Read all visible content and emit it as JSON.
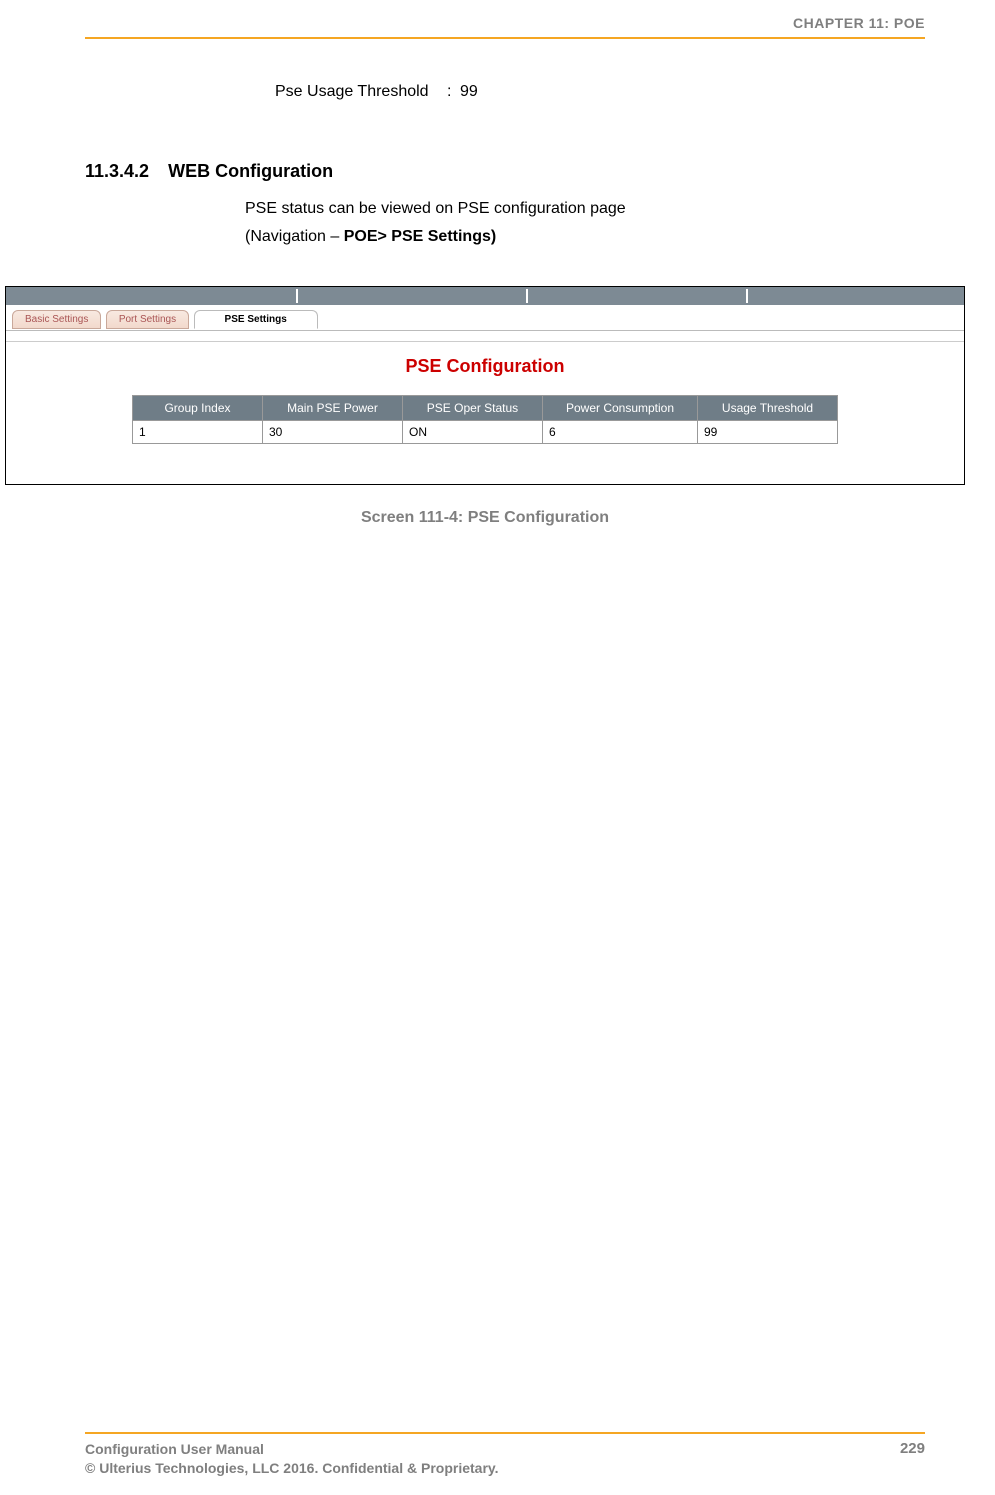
{
  "header": {
    "chapter": "CHAPTER 11: POE"
  },
  "threshold": {
    "label": "Pse Usage Threshold",
    "value": "99"
  },
  "section": {
    "number": "11.3.4.2",
    "title": "WEB Configuration",
    "body": "PSE status can be viewed on PSE configuration page",
    "nav_prefix": "(Navigation – ",
    "nav_bold": "POE> PSE Settings)",
    "nav_suffix": ""
  },
  "figure": {
    "tabs": {
      "basic": "Basic Settings",
      "port": "Port Settings",
      "pse": "PSE Settings"
    },
    "title": "PSE Configuration",
    "table": {
      "headers": [
        "Group Index",
        "Main PSE Power",
        "PSE Oper Status",
        "Power Consumption",
        "Usage Threshold"
      ],
      "rows": [
        [
          "1",
          "30",
          "ON",
          "6",
          "99"
        ]
      ]
    },
    "caption": "Screen 111-4: PSE Configuration"
  },
  "footer": {
    "line1": "Configuration User Manual",
    "line2": "© Ulterius Technologies, LLC 2016. Confidential & Proprietary.",
    "page": "229"
  }
}
